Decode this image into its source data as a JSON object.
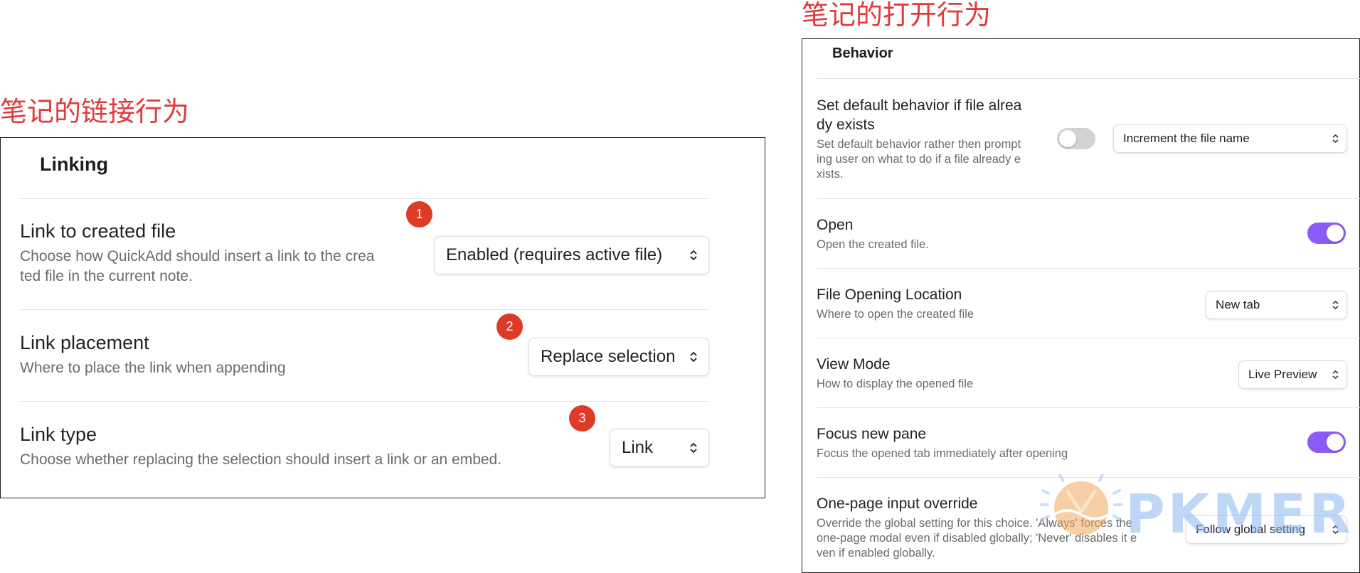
{
  "captions": {
    "left": "笔记的链接行为",
    "right": "笔记的打开行为"
  },
  "linking": {
    "title": "Linking",
    "rows": [
      {
        "name": "Link to created file",
        "desc_line1": "Choose how QuickAdd should insert a link to the crea",
        "desc_line2": "ted file in the current note.",
        "value": "Enabled (requires active file)",
        "badge": "1"
      },
      {
        "name": "Link placement",
        "desc": "Where to place the link when appending",
        "value": "Replace selection",
        "badge": "2"
      },
      {
        "name": "Link type",
        "desc": "Choose whether replacing the selection should insert a link or an embed.",
        "value": "Link",
        "badge": "3"
      }
    ]
  },
  "behavior": {
    "title": "Behavior",
    "rows": [
      {
        "name_line1": "Set default behavior if file alrea",
        "name_line2": "dy exists",
        "desc_line1": "Set default behavior rather then prompt",
        "desc_line2": "ing user on what to do if a file already e",
        "desc_line3": "xists.",
        "toggle": "off",
        "value": "Increment the file name"
      },
      {
        "name": "Open",
        "desc": "Open the created file.",
        "toggle": "on"
      },
      {
        "name": "File Opening Location",
        "desc": "Where to open the created file",
        "value": "New tab"
      },
      {
        "name": "View Mode",
        "desc": "How to display the opened file",
        "value": "Live Preview"
      },
      {
        "name": "Focus new pane",
        "desc": "Focus the opened tab immediately after opening",
        "toggle": "on"
      },
      {
        "name": "One-page input override",
        "desc_line1": "Override the global setting for this choice. 'Always' forces the",
        "desc_line2": "one-page modal even if disabled globally; 'Never' disables it e",
        "desc_line3": "ven if enabled globally.",
        "value": "Follow global setting"
      }
    ]
  },
  "watermark": {
    "text": "PKMER"
  },
  "colors": {
    "accent": "#8a5cf5",
    "caption": "#e03b3b",
    "badge": "#dd3b28"
  },
  "icons": {
    "dropdown": "chevron-up-down-icon",
    "watermark_logo": "pkmer-logo-icon"
  }
}
